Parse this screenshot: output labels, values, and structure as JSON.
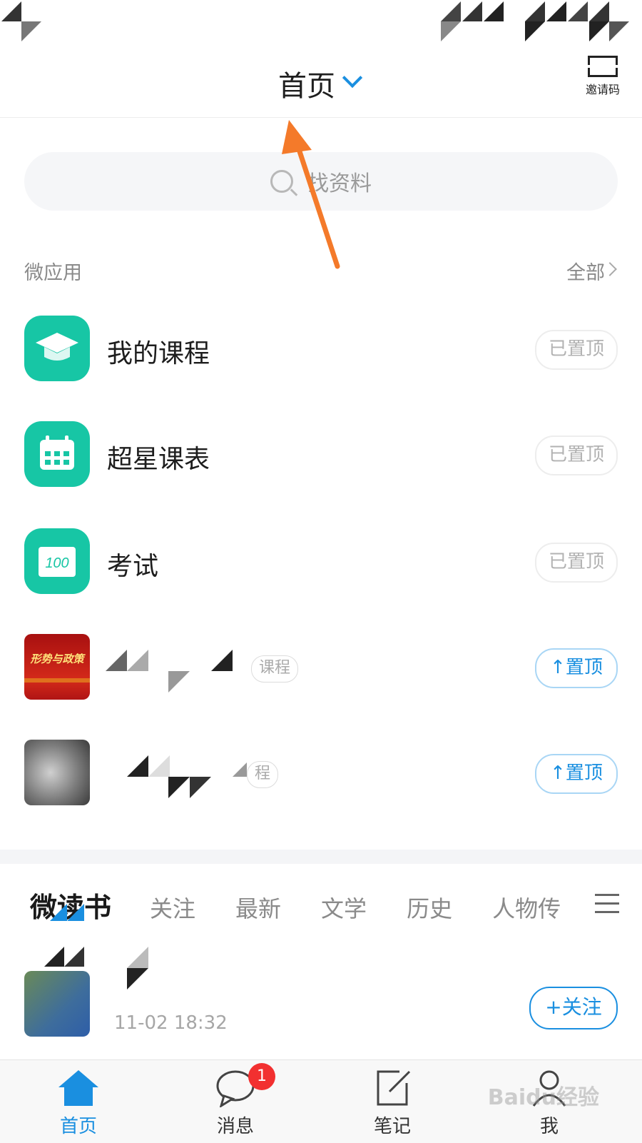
{
  "header": {
    "title": "首页",
    "invite_label": "邀请码"
  },
  "search": {
    "placeholder": "找资料"
  },
  "micro_apps": {
    "label": "微应用",
    "all_label": "全部",
    "items": [
      {
        "name": "我的课程",
        "action": "已置顶",
        "icon": "graduation-cap-icon"
      },
      {
        "name": "超星课表",
        "action": "已置顶",
        "icon": "calendar-icon"
      },
      {
        "name": "考试",
        "action": "已置顶",
        "icon": "exam-100-icon"
      },
      {
        "name": "",
        "tag": "课程",
        "action": "↑置顶",
        "icon": "course-thumbnail",
        "thumb_text": "形势与政策"
      },
      {
        "name": "",
        "tag": "程",
        "action": "↑置顶",
        "icon": "course-thumbnail"
      }
    ]
  },
  "reading": {
    "main_tab": "微读书",
    "tabs": [
      "关注",
      "最新",
      "文学",
      "历史",
      "人物传"
    ]
  },
  "feed": {
    "time": "11-02 18:32",
    "follow_label": "+关注"
  },
  "bottom_nav": [
    {
      "label": "首页",
      "icon": "home-icon",
      "active": true
    },
    {
      "label": "消息",
      "icon": "chat-bubble-icon",
      "badge": "1"
    },
    {
      "label": "笔记",
      "icon": "edit-note-icon"
    },
    {
      "label": "我",
      "icon": "person-icon"
    }
  ],
  "watermark": "Baidu经验",
  "colors": {
    "accent": "#1a8fe0",
    "app_green": "#17c6a5",
    "badge_red": "#f23030",
    "annotation_arrow": "#f47a2a"
  }
}
